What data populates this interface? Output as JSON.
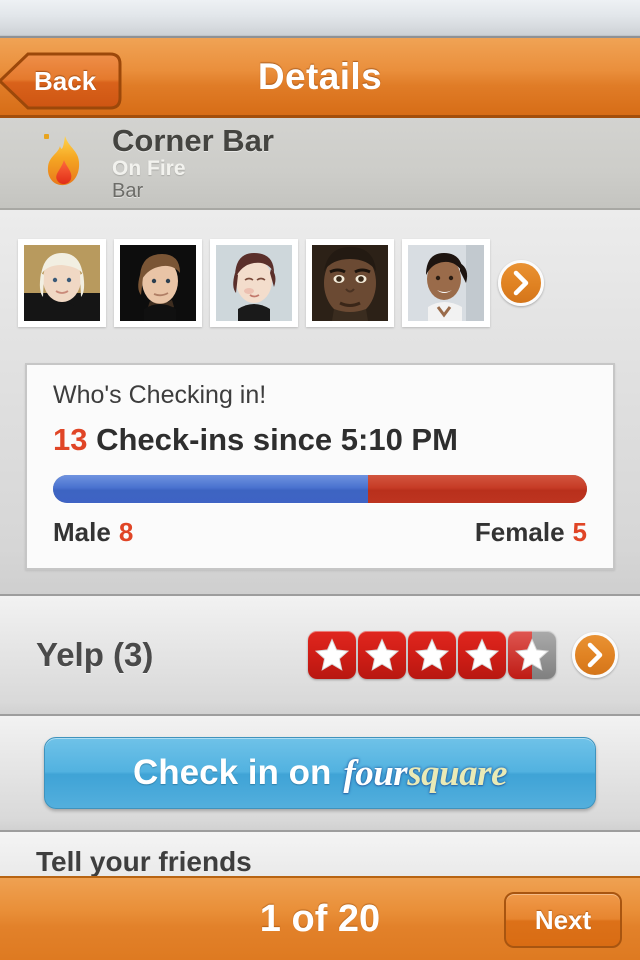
{
  "navbar": {
    "back_label": "Back",
    "title": "Details"
  },
  "venue": {
    "icon": "flame-icon",
    "name": "Corner Bar",
    "status": "On Fire",
    "category": "Bar"
  },
  "photos": {
    "more_icon": "chevron-right-icon",
    "items": [
      {
        "alt": "portrait-1",
        "skin": "#f0d8c4",
        "hair": "#f2efe2",
        "bg": "#b89a5e",
        "shirt": "#151515"
      },
      {
        "alt": "portrait-2",
        "skin": "#e9c4a6",
        "hair": "#7a5535",
        "bg": "#0d0d0d",
        "shirt": "#101010"
      },
      {
        "alt": "portrait-3",
        "skin": "#f3ddcc",
        "hair": "#5a2f2a",
        "bg": "#ced7db",
        "shirt": "#1a1a1a"
      },
      {
        "alt": "portrait-4",
        "skin": "#6b4a33",
        "hair": "#231a12",
        "bg": "#2c2117",
        "shirt": "#3a2c1f"
      },
      {
        "alt": "portrait-5",
        "skin": "#9a6b4a",
        "hair": "#1d1410",
        "bg": "#d8dde2",
        "shirt": "#f2f2f2"
      }
    ]
  },
  "checkin": {
    "title": "Who's Checking in!",
    "count": "13",
    "headline_rest": "Check-ins since 5:10 PM",
    "male_label": "Male",
    "male_count": "8",
    "female_label": "Female",
    "female_count": "5",
    "male_pct": 59,
    "female_pct": 41,
    "accent_color": "#e04526",
    "male_color": "#4a72cf",
    "female_color": "#c63b26"
  },
  "yelp": {
    "label": "Yelp (3)",
    "rating": 4.5,
    "stars_total": 5,
    "star_color": "#cf1d16",
    "star_empty_color": "#8e8e8e",
    "more_icon": "chevron-right-icon"
  },
  "foursquare": {
    "prefix": "Check in on",
    "logo_part1": "four",
    "logo_part2": "square",
    "button_color": "#52b2e0"
  },
  "tell": {
    "label": "Tell your friends"
  },
  "toolbar": {
    "count_label": "1 of 20",
    "next_label": "Next"
  }
}
